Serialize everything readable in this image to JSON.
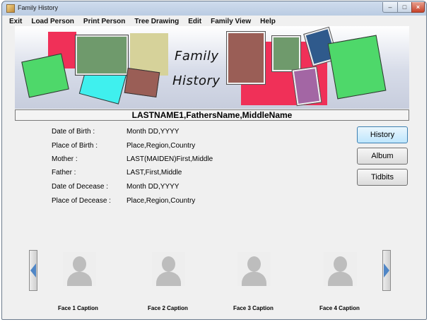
{
  "window": {
    "title": "Family History",
    "controls": {
      "minimize": "–",
      "maximize": "□",
      "close": "×"
    }
  },
  "menu": [
    "Exit",
    "Load Person",
    "Print Person",
    "Tree Drawing",
    "Edit",
    "Family View",
    "Help"
  ],
  "banner": {
    "line1": "Family",
    "line2": "History"
  },
  "person": {
    "name": "LASTNAME1,FathersName,MiddleName",
    "fields": [
      {
        "label": "Date of Birth :",
        "value": "Month DD,YYYY"
      },
      {
        "label": "Place of Birth :",
        "value": "Place,Region,Country"
      },
      {
        "label": "Mother :",
        "value": "LAST(MAIDEN)First,Middle"
      },
      {
        "label": "Father :",
        "value": "LAST,First,Middle"
      },
      {
        "label": "Date of Decease :",
        "value": "Month DD,YYYY"
      },
      {
        "label": "Place of Decease :",
        "value": "Place,Region,Country"
      }
    ]
  },
  "buttons": {
    "history": "History",
    "album": "Album",
    "tidbits": "Tidbits"
  },
  "faces": [
    {
      "caption": "Face 1 Caption"
    },
    {
      "caption": "Face 2 Caption"
    },
    {
      "caption": "Face 3 Caption"
    },
    {
      "caption": "Face 4 Caption"
    }
  ],
  "icons": {
    "app": "family-tree-icon",
    "scroll_left": "scroll-left-icon",
    "scroll_right": "scroll-right-icon",
    "placeholder": "person-silhouette-icon"
  },
  "colors": {
    "red": "#f03058",
    "green": "#4ed86a",
    "cyan": "#3ff0ee",
    "tan": "#d6d29a",
    "olive": "#6f9a6c",
    "brown": "#9a5e56",
    "navy": "#2f5a8c",
    "purple": "#a366a4",
    "arrow_blue": "#4f86c6"
  }
}
